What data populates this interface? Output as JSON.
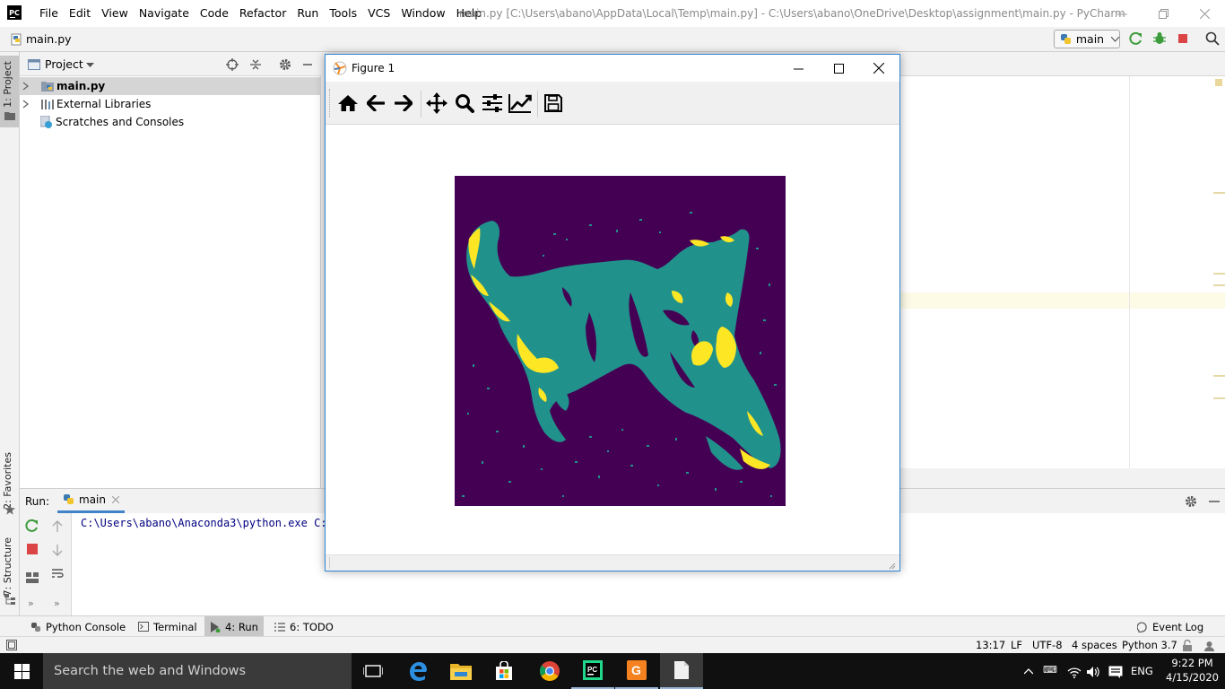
{
  "titlebar": {
    "app_icon": "pycharm-logo",
    "app_icon_text": "PC",
    "menu": [
      "File",
      "Edit",
      "View",
      "Navigate",
      "Code",
      "Refactor",
      "Run",
      "Tools",
      "VCS",
      "Window",
      "Help"
    ],
    "window_title": "main.py [C:\\Users\\abano\\AppData\\Local\\Temp\\main.py] - C:\\Users\\abano\\OneDrive\\Desktop\\assignment\\main.py - PyCharm"
  },
  "navbar": {
    "breadcrumb": "main.py",
    "run_config": "main",
    "icons": [
      "rerun-icon",
      "debug-icon",
      "stop-icon",
      "search-icon"
    ]
  },
  "left_strip": {
    "project_tab": "1: Project",
    "favorites_tab": "2: Favorites",
    "structure_tab": "7: Structure"
  },
  "project_panel": {
    "title": "Project",
    "tree": [
      {
        "label": "main.py",
        "bold": true,
        "expandable": true
      },
      {
        "label": "External Libraries",
        "bold": false,
        "expandable": true
      },
      {
        "label": "Scratches and Consoles",
        "bold": false,
        "expandable": false
      }
    ]
  },
  "run_panel": {
    "label": "Run:",
    "tab": "main",
    "console_line": "C:\\Users\\abano\\Anaconda3\\python.exe C:/"
  },
  "bottom_tools": {
    "python_console": "Python Console",
    "terminal": "Terminal",
    "run": "4: Run",
    "todo": "6: TODO",
    "event_log": "Event Log"
  },
  "statusbar": {
    "position": "13:17",
    "line_sep": "LF",
    "encoding": "UTF-8",
    "indent": "4 spaces",
    "interpreter": "Python 3.7"
  },
  "taskbar": {
    "search_placeholder": "Search the web and Windows",
    "language": "ENG",
    "time": "9:22 PM",
    "date": "4/15/2020"
  },
  "figure": {
    "title": "Figure 1",
    "toolbar": [
      "home-icon",
      "back-icon",
      "forward-icon",
      "pan-icon",
      "zoom-icon",
      "configure-subplots-icon",
      "edit-axes-icon",
      "save-icon"
    ],
    "colormap": {
      "low": "#440154",
      "mid": "#21918c",
      "high": "#fde725"
    }
  },
  "colors": {
    "ide_bg": "#f2f2f2",
    "console_text": "#000080",
    "figure_border": "#2f87d4",
    "taskbar": "#101010"
  }
}
